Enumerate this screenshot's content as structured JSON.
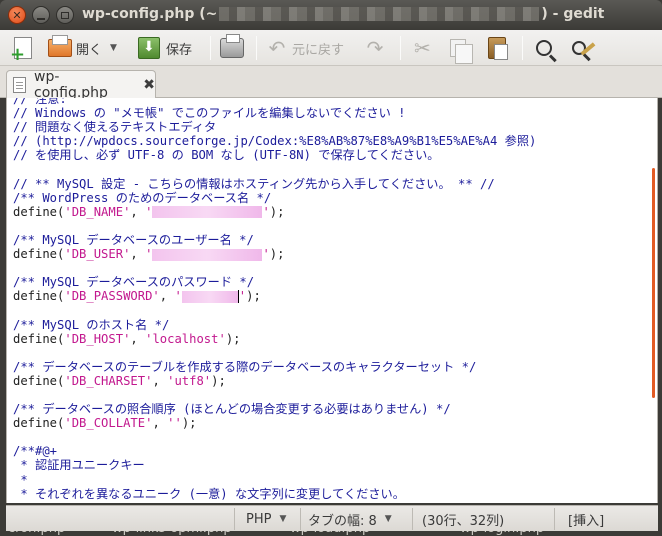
{
  "window": {
    "title_prefix": "wp-config.php (~",
    "title_suffix": ") - gedit"
  },
  "toolbar": {
    "open_label": "開く",
    "save_label": "保存",
    "undo_label": "元に戻す"
  },
  "tab": {
    "label": "wp-config.php"
  },
  "editor": {
    "lines": [
      {
        "parts": [
          {
            "t": "c",
            "v": "// 注意:"
          }
        ]
      },
      {
        "parts": [
          {
            "t": "c",
            "v": "// Windows の \"メモ帳\" でこのファイルを編集しないでください !"
          }
        ]
      },
      {
        "parts": [
          {
            "t": "c",
            "v": "// 問題なく使えるテキストエディタ"
          }
        ]
      },
      {
        "parts": [
          {
            "t": "c",
            "v": "// ("
          },
          {
            "t": "u",
            "v": "http://wpdocs.sourceforge.jp/Codex:%E8%AB%87%E8%A9%B1%E5%AE%A4"
          },
          {
            "t": "c",
            "v": " 参照)"
          }
        ]
      },
      {
        "parts": [
          {
            "t": "c",
            "v": "// を使用し、必ず UTF-8 の BOM なし (UTF-8N) で保存してください。"
          }
        ]
      },
      {
        "parts": []
      },
      {
        "parts": [
          {
            "t": "c",
            "v": "// ** MySQL 設定 - こちらの情報はホスティング先から入手してください。 ** //"
          }
        ]
      },
      {
        "parts": [
          {
            "t": "c",
            "v": "/** WordPress のためのデータベース名 */"
          }
        ]
      },
      {
        "parts": [
          {
            "t": "k",
            "v": "define("
          },
          {
            "t": "s",
            "v": "'DB_NAME'"
          },
          {
            "t": "k",
            "v": ", "
          },
          {
            "t": "s",
            "v": "'"
          },
          {
            "t": "r",
            "v": "110"
          },
          {
            "t": "s",
            "v": "'"
          },
          {
            "t": "k",
            "v": ");"
          }
        ]
      },
      {
        "parts": []
      },
      {
        "parts": [
          {
            "t": "c",
            "v": "/** MySQL データベースのユーザー名 */"
          }
        ]
      },
      {
        "parts": [
          {
            "t": "k",
            "v": "define("
          },
          {
            "t": "s",
            "v": "'DB_USER'"
          },
          {
            "t": "k",
            "v": ", "
          },
          {
            "t": "s",
            "v": "'"
          },
          {
            "t": "r",
            "v": "110"
          },
          {
            "t": "s",
            "v": "'"
          },
          {
            "t": "k",
            "v": ");"
          }
        ]
      },
      {
        "parts": []
      },
      {
        "parts": [
          {
            "t": "c",
            "v": "/** MySQL データベースのパスワード */"
          }
        ]
      },
      {
        "parts": [
          {
            "t": "k",
            "v": "define("
          },
          {
            "t": "s",
            "v": "'DB_PASSWORD'"
          },
          {
            "t": "k",
            "v": ", "
          },
          {
            "t": "s",
            "v": "'"
          },
          {
            "t": "r",
            "v": "56"
          },
          {
            "t": "cur",
            "v": ""
          },
          {
            "t": "s",
            "v": "'"
          },
          {
            "t": "k",
            "v": ");"
          }
        ]
      },
      {
        "parts": []
      },
      {
        "parts": [
          {
            "t": "c",
            "v": "/** MySQL のホスト名 */"
          }
        ]
      },
      {
        "parts": [
          {
            "t": "k",
            "v": "define("
          },
          {
            "t": "s",
            "v": "'DB_HOST'"
          },
          {
            "t": "k",
            "v": ", "
          },
          {
            "t": "s",
            "v": "'localhost'"
          },
          {
            "t": "k",
            "v": ");"
          }
        ]
      },
      {
        "parts": []
      },
      {
        "parts": [
          {
            "t": "c",
            "v": "/** データベースのテーブルを作成する際のデータベースのキャラクターセット */"
          }
        ]
      },
      {
        "parts": [
          {
            "t": "k",
            "v": "define("
          },
          {
            "t": "s",
            "v": "'DB_CHARSET'"
          },
          {
            "t": "k",
            "v": ", "
          },
          {
            "t": "s",
            "v": "'utf8'"
          },
          {
            "t": "k",
            "v": ");"
          }
        ]
      },
      {
        "parts": []
      },
      {
        "parts": [
          {
            "t": "c",
            "v": "/** データベースの照合順序 (ほとんどの場合変更する必要はありません) */"
          }
        ]
      },
      {
        "parts": [
          {
            "t": "k",
            "v": "define("
          },
          {
            "t": "s",
            "v": "'DB_COLLATE'"
          },
          {
            "t": "k",
            "v": ", "
          },
          {
            "t": "s",
            "v": "''"
          },
          {
            "t": "k",
            "v": ");"
          }
        ]
      },
      {
        "parts": []
      },
      {
        "parts": [
          {
            "t": "c",
            "v": "/**#@+"
          }
        ]
      },
      {
        "parts": [
          {
            "t": "c",
            "v": " * 認証用ユニークキー"
          }
        ]
      },
      {
        "parts": [
          {
            "t": "c",
            "v": " *"
          }
        ]
      },
      {
        "parts": [
          {
            "t": "c",
            "v": " * それぞれを異なるユニーク (一意) な文字列に変更してください。"
          }
        ]
      }
    ]
  },
  "statusbar": {
    "language": "PHP",
    "tab_width": "タブの幅: 8",
    "position": "(30行、32列)",
    "mode": "[挿入]"
  },
  "background_files": [
    "cron.php",
    "wp-links-opml.php",
    "wp-load.php",
    "wp-login.php"
  ],
  "colors": {
    "accent": "#e25b24",
    "string": "#c2188e",
    "comment": "#1c1c9a"
  }
}
